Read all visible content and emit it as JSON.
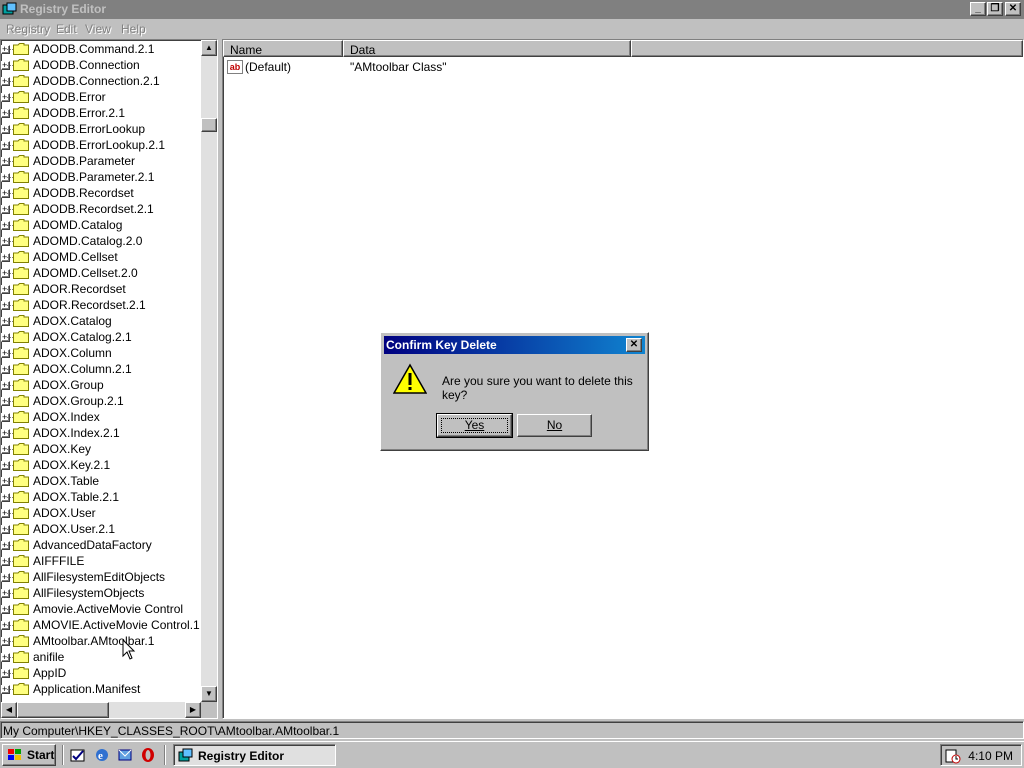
{
  "window": {
    "title": "Registry Editor",
    "minimize": "_",
    "restore": "❐",
    "close": "✕"
  },
  "menu": [
    "Registry",
    "Edit",
    "View",
    "Help"
  ],
  "tree": {
    "items": [
      "ADODB.Command.2.1",
      "ADODB.Connection",
      "ADODB.Connection.2.1",
      "ADODB.Error",
      "ADODB.Error.2.1",
      "ADODB.ErrorLookup",
      "ADODB.ErrorLookup.2.1",
      "ADODB.Parameter",
      "ADODB.Parameter.2.1",
      "ADODB.Recordset",
      "ADODB.Recordset.2.1",
      "ADOMD.Catalog",
      "ADOMD.Catalog.2.0",
      "ADOMD.Cellset",
      "ADOMD.Cellset.2.0",
      "ADOR.Recordset",
      "ADOR.Recordset.2.1",
      "ADOX.Catalog",
      "ADOX.Catalog.2.1",
      "ADOX.Column",
      "ADOX.Column.2.1",
      "ADOX.Group",
      "ADOX.Group.2.1",
      "ADOX.Index",
      "ADOX.Index.2.1",
      "ADOX.Key",
      "ADOX.Key.2.1",
      "ADOX.Table",
      "ADOX.Table.2.1",
      "ADOX.User",
      "ADOX.User.2.1",
      "AdvancedDataFactory",
      "AIFFFILE",
      "AllFilesystemEditObjects",
      "AllFilesystemObjects",
      "Amovie.ActiveMovie Control",
      "AMOVIE.ActiveMovie Control.1",
      "AMtoolbar.AMtoolbar.1",
      "anifile",
      "AppID",
      "Application.Manifest"
    ],
    "selected": "AMtoolbar.AMtoolbar.1"
  },
  "list": {
    "columns": [
      "Name",
      "Data"
    ],
    "rows": [
      {
        "name": "(Default)",
        "data": "\"AMtoolbar Class\"",
        "icon": "string-value-icon"
      }
    ]
  },
  "status": {
    "path": "My Computer\\HKEY_CLASSES_ROOT\\AMtoolbar.AMtoolbar.1"
  },
  "dialog": {
    "title": "Confirm Key Delete",
    "message": "Are you sure you want to delete this key?",
    "yes_label": "Yes",
    "no_label": "No",
    "close": "✕"
  },
  "taskbar": {
    "start_label": "Start",
    "task_label": "Registry Editor",
    "clock": "4:10 PM"
  }
}
